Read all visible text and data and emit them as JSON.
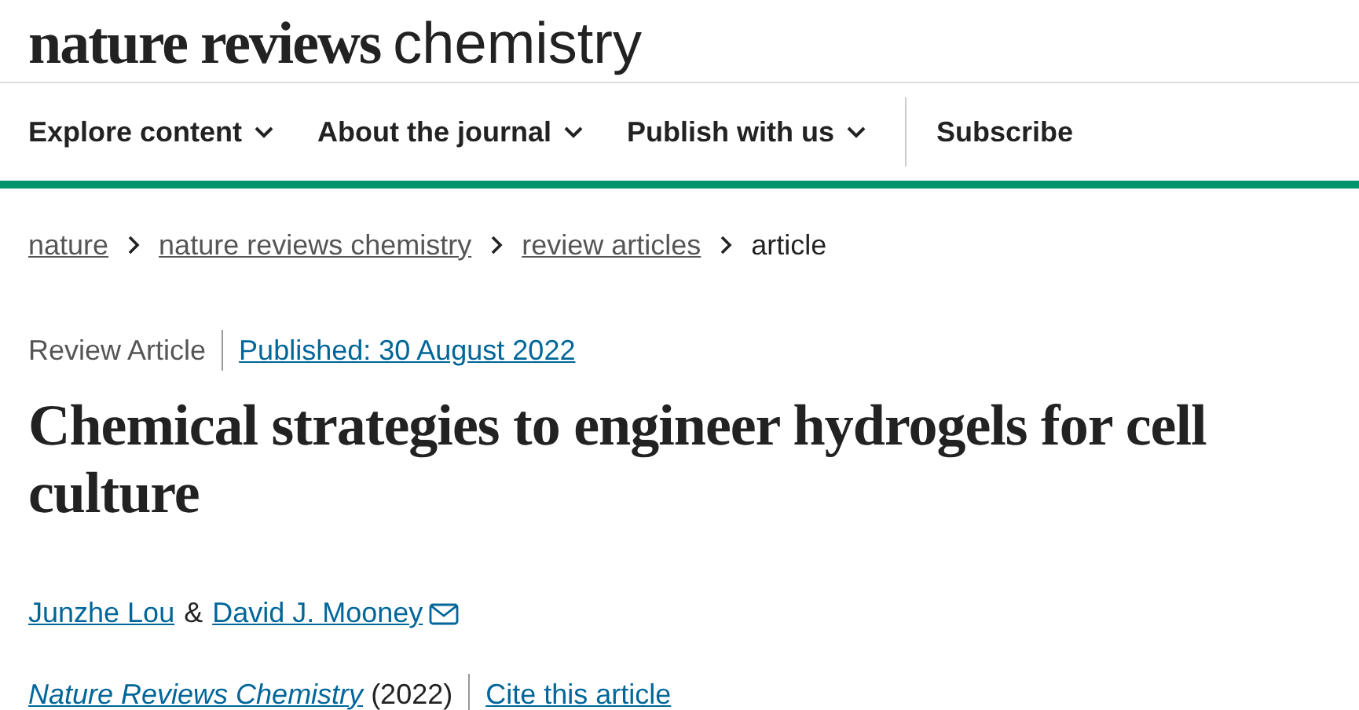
{
  "logo": {
    "brand": "nature reviews",
    "subject": "chemistry"
  },
  "nav": [
    {
      "label": "Explore content",
      "kind": "menu"
    },
    {
      "label": "About the journal",
      "kind": "menu"
    },
    {
      "label": "Publish with us",
      "kind": "menu"
    },
    {
      "label": "Subscribe",
      "kind": "link"
    }
  ],
  "breadcrumbs": [
    {
      "label": "nature",
      "kind": "link"
    },
    {
      "label": "nature reviews chemistry",
      "kind": "link"
    },
    {
      "label": "review articles",
      "kind": "link"
    },
    {
      "label": "article",
      "kind": "current"
    }
  ],
  "article": {
    "type": "Review Article",
    "published": "Published: 30 August 2022",
    "title": "Chemical strategies to engineer hydrogels for cell culture",
    "authors": [
      {
        "name": "Junzhe Lou",
        "email": false
      },
      {
        "name": "David J. Mooney",
        "email": true
      }
    ],
    "author_separator": "&",
    "journal": "Nature Reviews Chemistry",
    "year": "(2022)",
    "cite": "Cite this article"
  }
}
